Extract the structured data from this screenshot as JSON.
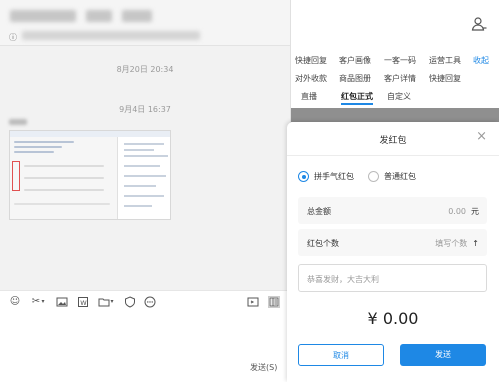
{
  "chat": {
    "times": [
      "8月20日 20:34",
      "9月4日 16:37"
    ],
    "send_label": "发送(S)"
  },
  "toolbar_icons": [
    "emoji-icon",
    "scissors-icon",
    "image-icon",
    "word-doc-icon",
    "folder-icon",
    "shield-icon",
    "more-icon",
    "screen-icon",
    "panel-icon"
  ],
  "side": {
    "tab_rows": [
      [
        "快捷回复",
        "客户画像",
        "一客一码",
        "运营工具",
        "收起"
      ],
      [
        "对外收款",
        "商品图册",
        "客户详情",
        "快捷回复"
      ],
      [
        "直播",
        "红包正式",
        "自定义"
      ]
    ],
    "active_tab": "红包正式"
  },
  "dialog": {
    "title": "发红包",
    "radio_lucky": "拼手气红包",
    "radio_normal": "普通红包",
    "total_label": "总金额",
    "total_value": "0.00",
    "total_unit": "元",
    "count_label": "红包个数",
    "count_placeholder": "填写个数",
    "blessing_placeholder": "恭喜发财，大吉大利",
    "amount": "¥ 0.00",
    "cancel": "取消",
    "send": "发送"
  },
  "colors": {
    "accent": "#1e88e5"
  }
}
